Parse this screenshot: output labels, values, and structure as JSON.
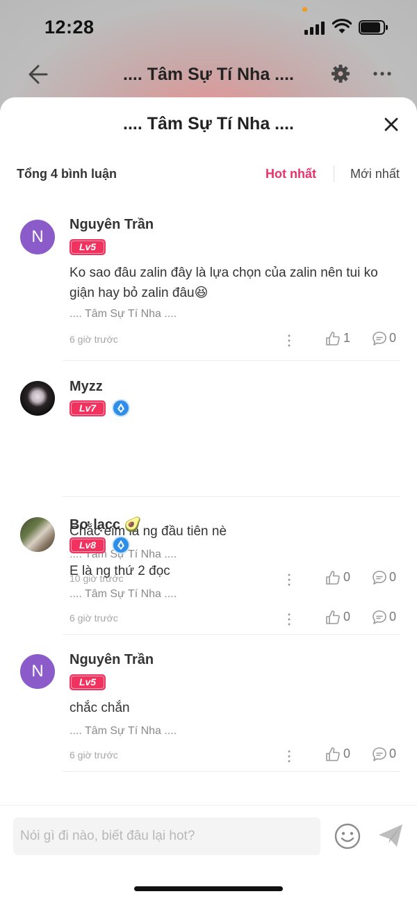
{
  "status_bar": {
    "time": "12:28"
  },
  "background_nav": {
    "title": ".... Tâm Sự Tí Nha ...."
  },
  "sheet": {
    "title": ".... Tâm Sự Tí Nha ....",
    "total_label": "Tổng 4 bình luận",
    "sort_hot": "Hot nhất",
    "sort_new": "Mới nhất",
    "accent_color": "#e8336a"
  },
  "comments": [
    {
      "avatar_letter": "N",
      "username": "Nguyên Trần",
      "level": "Lv5",
      "text": "Ko sao đâu zalin đây là lựa chọn của zalin nên tui ko giận hay bỏ zalin đâu😆",
      "source": ".... Tâm Sự Tí Nha ....",
      "time": "6 giờ trước",
      "likes": "1",
      "replies": "0"
    },
    {
      "username": "Myzz",
      "level": "Lv7",
      "text": "Chắc eim là ng đầu tiên nè",
      "source": ".... Tâm Sự Tí Nha ....",
      "time": "10 giờ trước",
      "likes": "0",
      "replies": "0"
    },
    {
      "username": "Bơ lạcc",
      "username_emoji": "🥑",
      "level": "Lv8",
      "text": "E là ng thứ 2 đọc",
      "source": ".... Tâm Sự Tí Nha ....",
      "time": "6 giờ trước",
      "likes": "0",
      "replies": "0"
    },
    {
      "avatar_letter": "N",
      "username": "Nguyên Trần",
      "level": "Lv5",
      "text": "chắc chắn",
      "source": ".... Tâm Sự Tí Nha ....",
      "time": "6 giờ trước",
      "likes": "0",
      "replies": "0"
    }
  ],
  "input_bar": {
    "placeholder": "Nói gì đi nào, biết đâu lại hot?",
    "value": ""
  },
  "icons": {
    "back": "arrow-left-icon",
    "settings": "gear-icon",
    "more": "more-horizontal-icon",
    "close": "close-icon",
    "like": "thumbs-up-icon",
    "reply": "comment-bubble-icon",
    "emoji": "smiley-icon",
    "send": "send-icon"
  }
}
